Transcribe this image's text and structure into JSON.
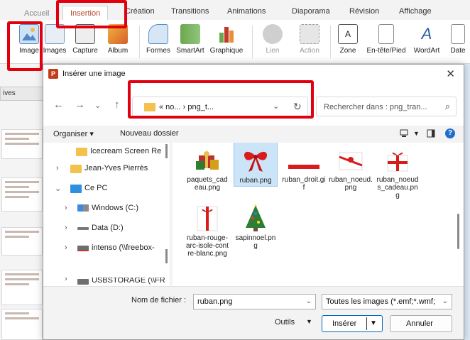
{
  "ribbon": {
    "tabs": [
      "Accueil",
      "Insertion",
      "Création",
      "Transitions",
      "Animations",
      "Diaporama",
      "Révision",
      "Affichage"
    ],
    "buttons": [
      "Image",
      "Images",
      "Capture",
      "Album",
      "Formes",
      "SmartArt",
      "Graphique",
      "Lien",
      "Action",
      "Zone",
      "En-tête/Pied",
      "WordArt",
      "Date"
    ]
  },
  "side_panel": {
    "tab_label": "ives"
  },
  "dialog": {
    "title": "Insérer une image",
    "breadcrumb": "«  no...  ›  png_t...",
    "search_placeholder": "Rechercher dans : png_tran...",
    "commands": {
      "organize": "Organiser ▾",
      "new_folder": "Nouveau dossier"
    },
    "tree": [
      {
        "label": "Icecream Screen Re",
        "icon": "folder-icon"
      },
      {
        "label": "Jean-Yves Pierrès",
        "icon": "folder-icon"
      },
      {
        "label": "Ce PC",
        "icon": "computer-icon"
      },
      {
        "label": "Windows (C:)",
        "icon": "windows-drive-icon"
      },
      {
        "label": "Data (D:)",
        "icon": "drive-icon"
      },
      {
        "label": "intenso (\\\\freebox-",
        "icon": "network-drive-icon"
      },
      {
        "label": "USBSTORAGE (\\\\FR",
        "icon": "network-drive-icon"
      }
    ],
    "files": [
      {
        "name": "paquets_cadeau.png",
        "selected": false,
        "icon": "gift-packages-icon"
      },
      {
        "name": "ruban.png",
        "selected": true,
        "icon": "red-bow-icon"
      },
      {
        "name": "ruban_droit.gif",
        "selected": false,
        "icon": "straight-ribbon-icon"
      },
      {
        "name": "ruban_noeud.png",
        "selected": false,
        "icon": "ribbon-knot-icon"
      },
      {
        "name": "ruban_noeuds_cadeau.png",
        "selected": false,
        "icon": "ribbon-gift-icon"
      },
      {
        "name": "ruban-rouge-arc-isole-contre-blanc.png",
        "selected": false,
        "icon": "red-ribbon-bow-icon"
      },
      {
        "name": "sapinnoel.png",
        "selected": false,
        "icon": "christmas-tree-icon"
      }
    ],
    "filename_label": "Nom de fichier :",
    "filename_value": "ruban.png",
    "filetype_value": "Toutes les images (*.emf;*.wmf;",
    "tools_label": "Outils",
    "insert_label": "Insérer",
    "cancel_label": "Annuler"
  },
  "colors": {
    "highlight": "#e2000f",
    "accent": "#0067c0",
    "selection": "#cce4f7",
    "folder": "#f2c14e"
  }
}
